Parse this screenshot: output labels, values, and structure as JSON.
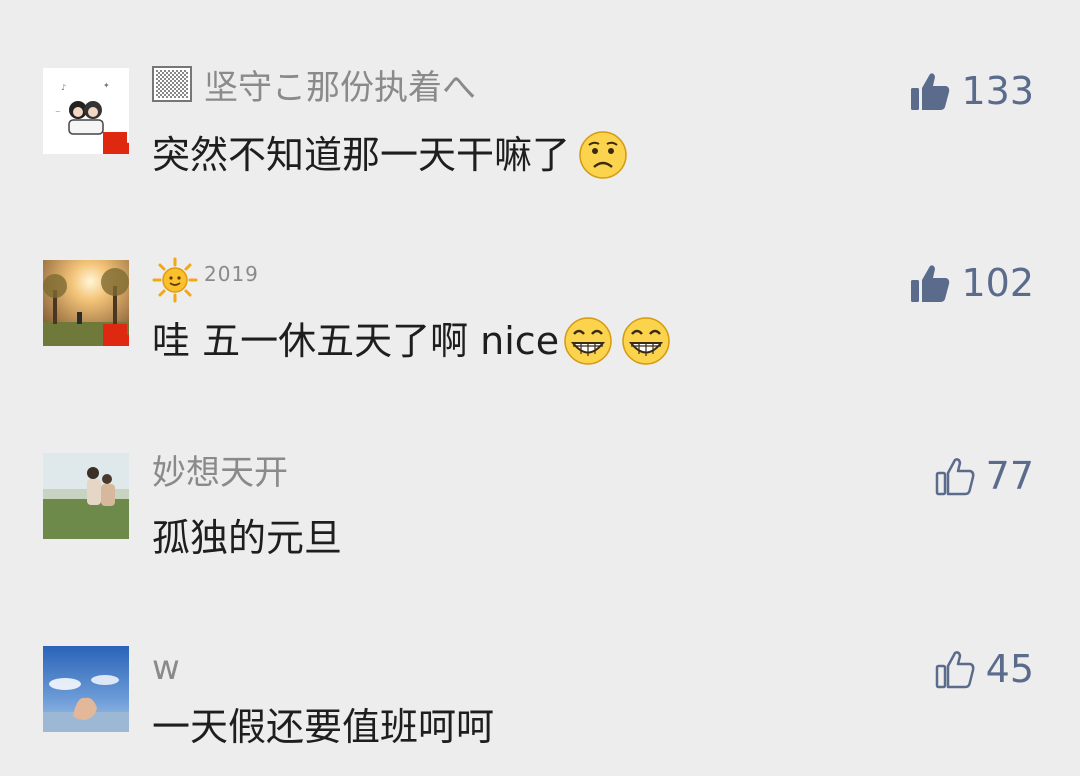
{
  "comments": [
    {
      "username": "坚守こ那份执着へ",
      "username_prefix_icon": "checker-badge-icon",
      "text": "突然不知道那一天干嘛了",
      "emojis": [
        "sad-face-icon"
      ],
      "likes": "133",
      "liked": true,
      "flag": true
    },
    {
      "username_prefix_icon": "sun-emoji-icon",
      "username_suffix": "2019",
      "text": "哇 五一休五天了啊 nice",
      "emojis": [
        "grin-face-icon",
        "grin-face-icon"
      ],
      "likes": "102",
      "liked": true,
      "flag": true
    },
    {
      "username": "妙想天开",
      "text": "孤独的元旦",
      "emojis": [],
      "likes": "77",
      "liked": false,
      "flag": false
    },
    {
      "username": "w",
      "text": "一天假还要值班呵呵",
      "emojis": [],
      "likes": "45",
      "liked": false,
      "flag": false
    }
  ],
  "colors": {
    "background": "#ededed",
    "username": "#8a8a8a",
    "text": "#1e1e1e",
    "like": "#5b6b8c",
    "flag_red": "#de2910"
  }
}
